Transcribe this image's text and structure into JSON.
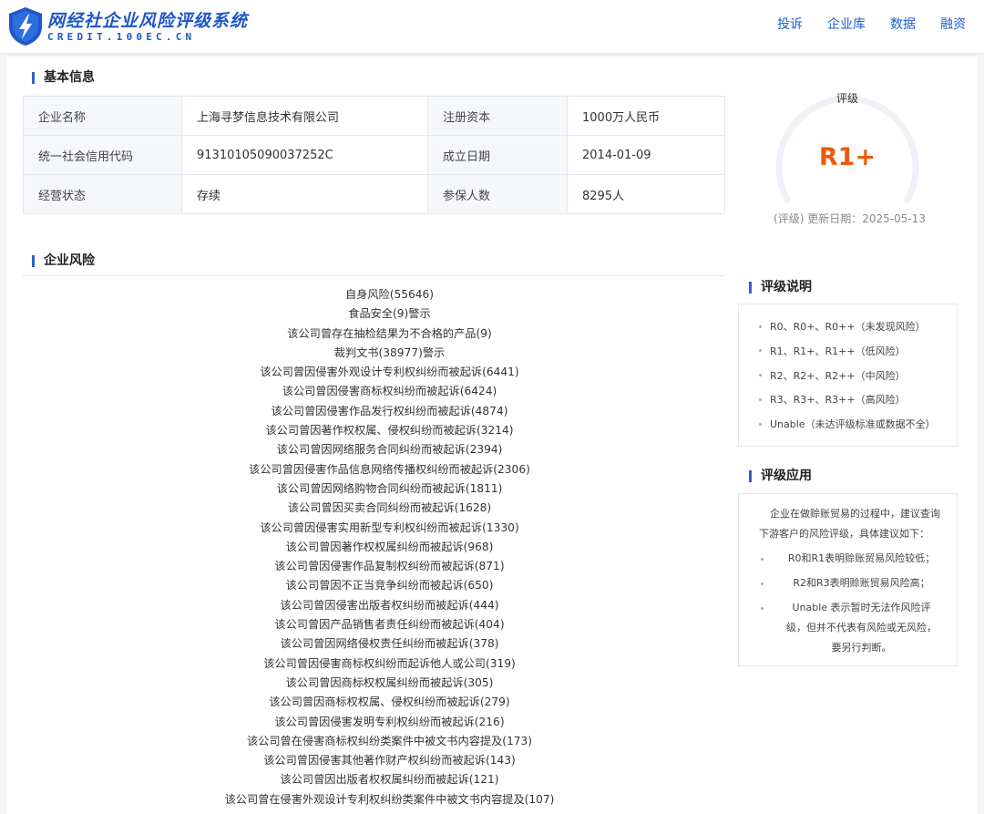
{
  "header": {
    "brand_title": "网经社企业风险评级系统",
    "brand_sub": "CREDIT.100EC.CN",
    "nav": [
      "投诉",
      "企业库",
      "数据",
      "融资"
    ]
  },
  "basic_info": {
    "title": "基本信息",
    "rows": [
      [
        {
          "label": "企业名称",
          "value": "上海寻梦信息技术有限公司"
        },
        {
          "label": "注册资本",
          "value": "1000万人民币"
        }
      ],
      [
        {
          "label": "统一社会信用代码",
          "value": "91310105090037252C"
        },
        {
          "label": "成立日期",
          "value": "2014-01-09"
        }
      ],
      [
        {
          "label": "经营状态",
          "value": "存续"
        },
        {
          "label": "参保人数",
          "value": "8295人"
        }
      ]
    ]
  },
  "rating": {
    "label": "评级",
    "value": "R1+",
    "update_date": "(评级) 更新日期：2025-05-13",
    "accent_color": "#f05a0a"
  },
  "risk": {
    "title": "企业风险",
    "items": [
      "自身风险(55646)",
      "食品安全(9)警示",
      "该公司曾存在抽检结果为不合格的产品(9)",
      "裁判文书(38977)警示",
      "该公司曾因侵害外观设计专利权纠纷而被起诉(6441)",
      "该公司曾因侵害商标权纠纷而被起诉(6424)",
      "该公司曾因侵害作品发行权纠纷而被起诉(4874)",
      "该公司曾因著作权权属、侵权纠纷而被起诉(3214)",
      "该公司曾因网络服务合同纠纷而被起诉(2394)",
      "该公司曾因侵害作品信息网络传播权纠纷而被起诉(2306)",
      "该公司曾因网络购物合同纠纷而被起诉(1811)",
      "该公司曾因买卖合同纠纷而被起诉(1628)",
      "该公司曾因侵害实用新型专利权纠纷而被起诉(1330)",
      "该公司曾因著作权权属纠纷而被起诉(968)",
      "该公司曾因侵害作品复制权纠纷而被起诉(871)",
      "该公司曾因不正当竞争纠纷而被起诉(650)",
      "该公司曾因侵害出版者权纠纷而被起诉(444)",
      "该公司曾因产品销售者责任纠纷而被起诉(404)",
      "该公司曾因网络侵权责任纠纷而被起诉(378)",
      "该公司曾因侵害商标权纠纷而起诉他人或公司(319)",
      "该公司曾因商标权权属纠纷而被起诉(305)",
      "该公司曾因商标权权属、侵权纠纷而被起诉(279)",
      "该公司曾因侵害发明专利权纠纷而被起诉(216)",
      "该公司曾在侵害商标权纠纷类案件中被文书内容提及(173)",
      "该公司曾因侵害其他著作财产权纠纷而被起诉(143)",
      "该公司曾因出版者权权属纠纷而被起诉(121)",
      "该公司曾在侵害外观设计专利权纠纷类案件中被文书内容提及(107)"
    ]
  },
  "explanation": {
    "title": "评级说明",
    "items": [
      "R0、R0+、R0++（未发现风险）",
      "R1、R1+、R1++（低风险）",
      "R2、R2+、R2++（中风险）",
      "R3、R3+、R3++（高风险）",
      "Unable（未达评级标准或数据不全）"
    ]
  },
  "application": {
    "title": "评级应用",
    "intro": "企业在做赊账贸易的过程中，建议查询下游客户的风险评级，具体建议如下：",
    "items": [
      "R0和R1表明赊账贸易风险较低；",
      "R2和R3表明赊账贸易风险高；",
      "Unable 表示暂时无法作风险评级，但并不代表有风险或无风险，要另行判断。"
    ]
  }
}
